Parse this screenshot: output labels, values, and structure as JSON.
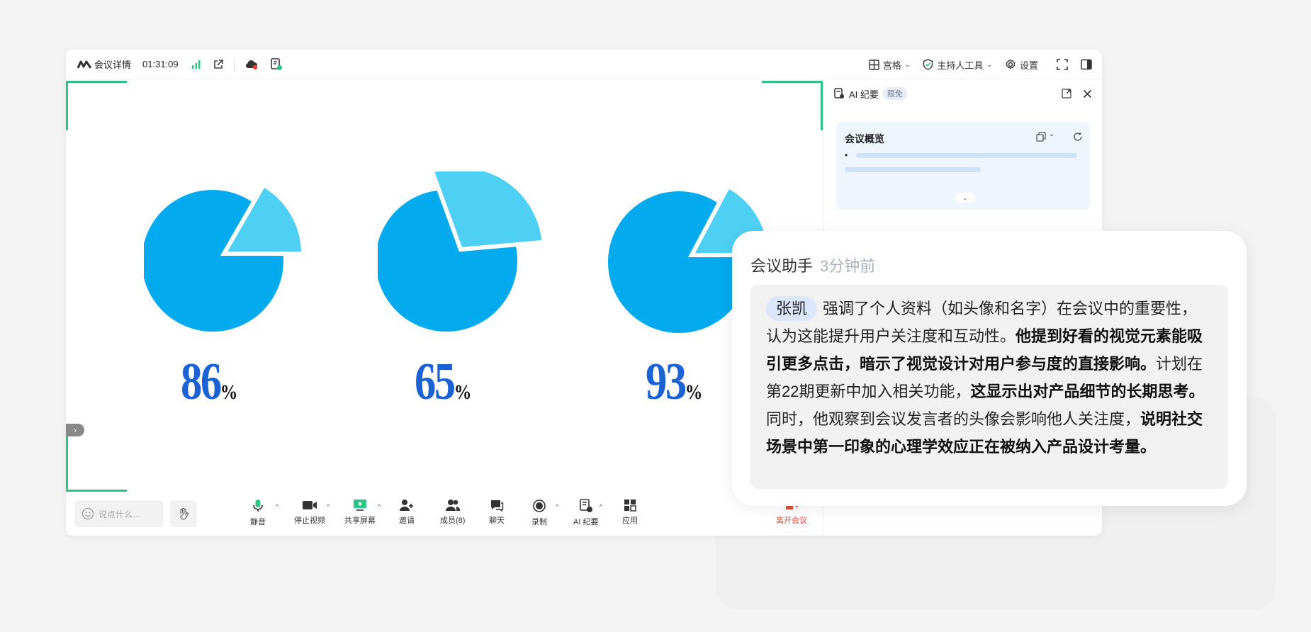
{
  "topbar": {
    "meeting_details": "会议详情",
    "elapsed": "01:31:09",
    "grid_label": "宫格",
    "host_tools_label": "主持人工具",
    "settings_label": "设置"
  },
  "share": {
    "pies": [
      {
        "value": 86,
        "sign": "%"
      },
      {
        "value": 65,
        "sign": "%"
      },
      {
        "value": 93,
        "sign": "%"
      }
    ],
    "colors": {
      "main": "#03aaee",
      "slice": "#4dd0f3",
      "number": "#1b63d4",
      "frame": "#2fc285"
    }
  },
  "ai_panel": {
    "title": "AI 纪要",
    "badge": "限免",
    "card_title": "会议概览",
    "bullet": "•"
  },
  "bottombar": {
    "say_placeholder": "说点什么...",
    "tools": {
      "mute": "静音",
      "stop_video": "停止视频",
      "share_screen": "共享屏幕",
      "invite": "邀请",
      "members": "成员(8)",
      "chat": "聊天",
      "record": "录制",
      "ai_summary": "AI 纪要",
      "apps": "应用",
      "leave": "离开会议"
    }
  },
  "assistant": {
    "title": "会议助手",
    "time": "3分钟前",
    "speaker": "张凯",
    "seg1": "强调了个人资料（如头像和名字）在会议中的重要性，认为这能提升用户关注度和互动性。",
    "seg2": "他提到好看的视觉元素能吸引更多点击，暗示了视觉设计对用户参与度的直接影响。",
    "seg3": "计划在第22期更新中加入相关功能，",
    "seg4": "这显示出对产品细节的长期思考。",
    "seg5": "同时，他观察到会议发言者的头像会影响他人关注度，",
    "seg6": "说明社交场景中第一印象的心理学效应正在被纳入产品设计考量。"
  }
}
